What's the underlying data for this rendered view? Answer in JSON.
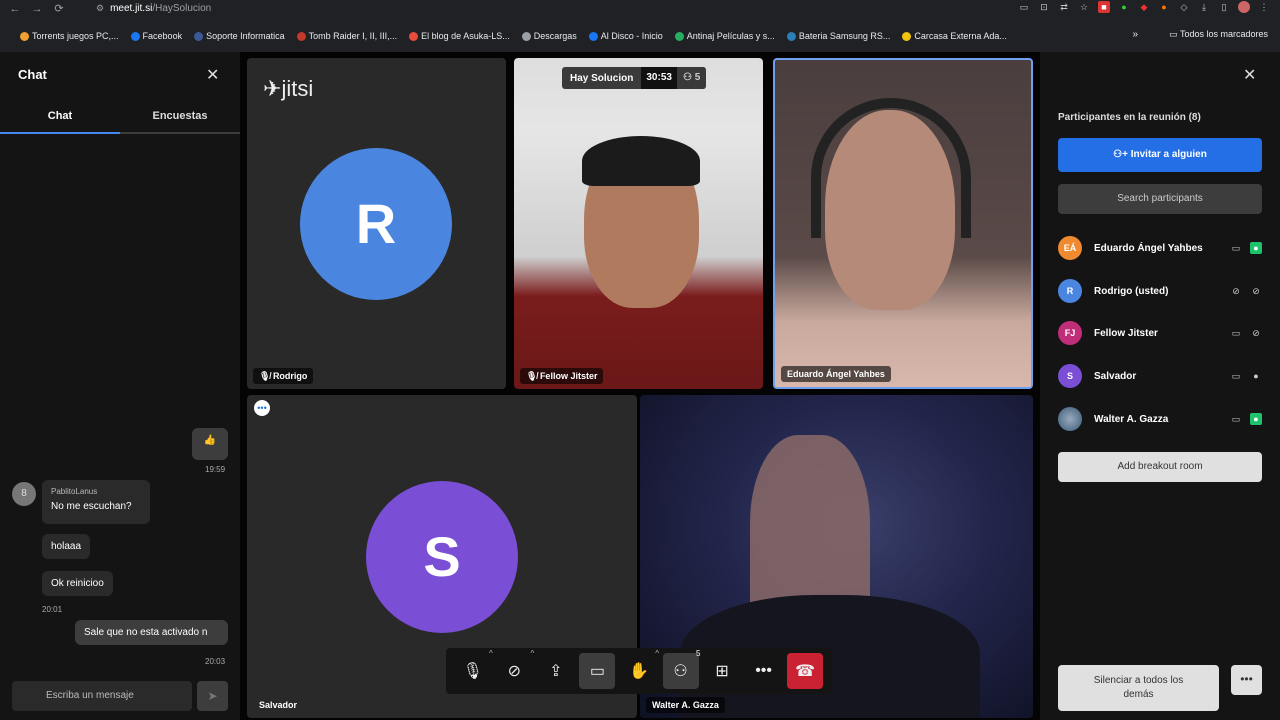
{
  "browser": {
    "url_host": "meet.jit.si",
    "url_path": "/HaySolucion",
    "bookmarks": [
      {
        "label": "Torrents juegos PC,...",
        "color": "#f0a030"
      },
      {
        "label": "Facebook",
        "color": "#1877f2"
      },
      {
        "label": "Soporte Informatica",
        "color": "#3b5998"
      },
      {
        "label": "Tomb Raider I, II, III,...",
        "color": "#c0392b"
      },
      {
        "label": "El blog de Asuka-LS...",
        "color": "#e74c3c"
      },
      {
        "label": "Descargas",
        "color": "#9aa0a6"
      },
      {
        "label": "Al Disco - Inicio",
        "color": "#1877f2"
      },
      {
        "label": "Antinaj Películas y s...",
        "color": "#27ae60"
      },
      {
        "label": "Bateria Samsung RS...",
        "color": "#2980b9"
      },
      {
        "label": "Carcasa Externa Ada...",
        "color": "#f1c40f"
      }
    ],
    "all_bookmarks": "Todos los marcadores"
  },
  "chat": {
    "title": "Chat",
    "tabs": [
      "Chat",
      "Encuestas"
    ],
    "reaction_emoji": "👍",
    "reaction_time": "19:59",
    "sender": "PablitoLanus",
    "sender_initial": "8",
    "messages": [
      "No me escuchan?",
      "holaaa",
      "Ok reinicioo"
    ],
    "time_1": "20:01",
    "own_message": "Sale que no esta activado n",
    "time_2": "20:03",
    "input_placeholder": "Escriba un mensaje"
  },
  "meeting": {
    "logo": "jitsi",
    "room_name": "Hay Solucion",
    "timer": "30:53",
    "participant_count": "5",
    "tiles": {
      "rodrigo": {
        "name": "Rodrigo",
        "initial": "R",
        "color": "#4a86e0"
      },
      "fellow": {
        "name": "Fellow Jitster"
      },
      "eduardo": {
        "name": "Eduardo Ángel Yahbes"
      },
      "salvador": {
        "name": "Salvador",
        "initial": "S",
        "color": "#7a4fd6"
      },
      "walter": {
        "name": "Walter A. Gazza"
      }
    },
    "toolbar_badge": "5"
  },
  "participants": {
    "title": "Participantes en la reunión (8)",
    "invite_label": "Invitar a alguien",
    "search_placeholder": "Search participants",
    "list": [
      {
        "name": "Eduardo Ángel Yahbes",
        "initials": "EÁ",
        "color": "#f08a30"
      },
      {
        "name": "Rodrigo (usted)",
        "initials": "R",
        "color": "#4a86e0"
      },
      {
        "name": "Fellow Jitster",
        "initials": "FJ",
        "color": "#c02e7a"
      },
      {
        "name": "Salvador",
        "initials": "S",
        "color": "#7a4fd6"
      },
      {
        "name": "Walter A. Gazza",
        "initials": "",
        "color": "#4a6a8a"
      }
    ],
    "breakout_label": "Add breakout room",
    "mute_all_label_1": "Silenciar a todos los",
    "mute_all_label_2": "demás",
    "more_label": "•••"
  },
  "colors": {
    "accent": "#246fe5",
    "hangup": "#cb2233",
    "active_speaker_border": "#6ea0f0"
  }
}
